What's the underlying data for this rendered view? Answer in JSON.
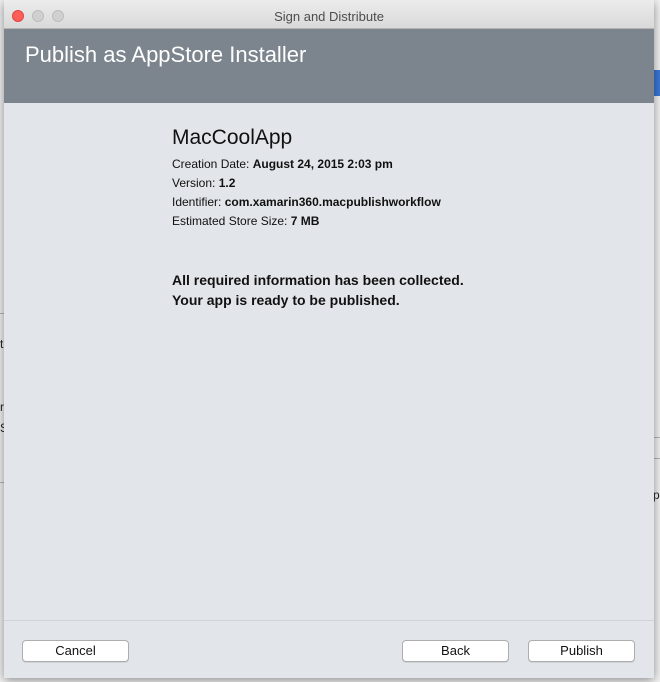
{
  "window": {
    "title": "Sign and Distribute"
  },
  "banner": {
    "title": "Publish as AppStore Installer"
  },
  "app": {
    "name": "MacCoolApp",
    "creation_date_label": "Creation Date:",
    "creation_date_value": "August 24, 2015 2:03 pm",
    "version_label": "Version:",
    "version_value": "1.2",
    "identifier_label": "Identifier:",
    "identifier_value": "com.xamarin360.macpublishworkflow",
    "size_label": "Estimated Store Size:",
    "size_value": "7 MB"
  },
  "message": {
    "line1": "All required information has been collected.",
    "line2": "Your app is ready to be published."
  },
  "buttons": {
    "cancel": "Cancel",
    "back": "Back",
    "publish": "Publish"
  },
  "background_fragments": {
    "frag1": "t",
    "frag2": "ri",
    "frag3": "S",
    "frag4": "p"
  },
  "colors": {
    "banner": "#7c858e",
    "sheet": "#e2e5e9",
    "close_button": "#fc5f57"
  }
}
